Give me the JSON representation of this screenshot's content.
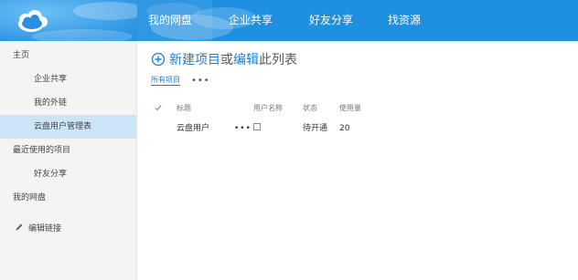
{
  "colors": {
    "top_bar": "#1f8fe0",
    "accent_link": "#1d7ed3",
    "sidebar_bg": "#f4f4f4",
    "selected_item": "#cde6f7"
  },
  "top_tabs": [
    {
      "label": "我的网盘",
      "active": true
    },
    {
      "label": "企业共享",
      "active": false
    },
    {
      "label": "好友分享",
      "active": false
    },
    {
      "label": "找资源",
      "active": false
    }
  ],
  "sidebar": {
    "items": [
      {
        "label": "主页",
        "level": 0
      },
      {
        "label": "企业共享",
        "level": 1
      },
      {
        "label": "我的外链",
        "level": 1
      },
      {
        "label": "云盘用户管理表",
        "level": 1,
        "selected": true
      },
      {
        "label": "最近使用的项目",
        "level": 0
      },
      {
        "label": "好友分享",
        "level": 1
      },
      {
        "label": "我的网盘",
        "level": 0
      }
    ],
    "edit_links": {
      "label": "编辑链接",
      "icon": "pencil-icon"
    }
  },
  "main": {
    "new_item": {
      "icon": "plus-circle-icon",
      "new_link": "新建项目",
      "or": "或",
      "edit_link": "编辑",
      "rest": "此列表"
    },
    "view": {
      "label": "所有项目",
      "more": "•••"
    },
    "table": {
      "columns": [
        "标题",
        "用户名称",
        "状态",
        "使用量"
      ],
      "rows": [
        {
          "title": "云盘用户",
          "menu": "•••",
          "user_checked": false,
          "status": "待开通",
          "usage": "20"
        }
      ]
    }
  }
}
